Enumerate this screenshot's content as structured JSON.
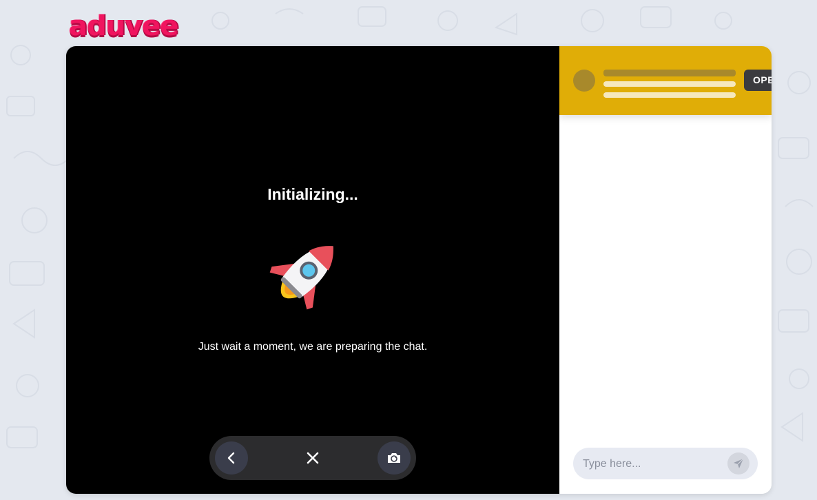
{
  "brand": {
    "logo_text": "aduvee",
    "logo_color": "#f0145f"
  },
  "video": {
    "title": "Initializing...",
    "message": "Just wait a moment, we are preparing the chat.",
    "icon": "rocket-icon",
    "controls": [
      {
        "name": "back",
        "icon": "chevron-left-icon"
      },
      {
        "name": "close",
        "icon": "close-icon"
      },
      {
        "name": "switch-camera",
        "icon": "camera-switch-icon"
      }
    ]
  },
  "chat": {
    "header_color": "#e0ad07",
    "open_button_label": "OPEN",
    "input_placeholder": "Type here...",
    "send_icon": "send-icon"
  }
}
